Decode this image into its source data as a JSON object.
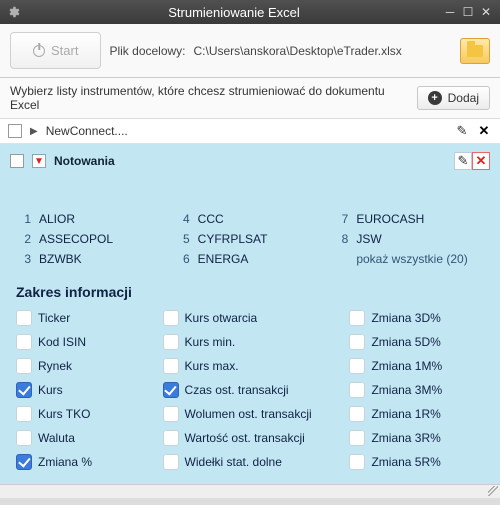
{
  "window": {
    "title": "Strumieniowanie Excel"
  },
  "toolbar": {
    "start_label": "Start",
    "file_label": "Plik docelowy:",
    "file_path": "C:\\Users\\anskora\\Desktop\\eTrader.xlsx"
  },
  "subbar": {
    "text": "Wybierz listy instrumentów, które chcesz strumieniować do dokumentu Excel",
    "add_label": "Dodaj"
  },
  "lists": {
    "row1_label": "NewConnect....",
    "panel_title": "Notowania"
  },
  "tickers": {
    "n1": "1",
    "l1": "ALIOR",
    "n2": "2",
    "l2": "ASSECOPOL",
    "n3": "3",
    "l3": "BZWBK",
    "n4": "4",
    "l4": "CCC",
    "n5": "5",
    "l5": "CYFRPLSAT",
    "n6": "6",
    "l6": "ENERGA",
    "n7": "7",
    "l7": "EUROCASH",
    "n8": "8",
    "l8": "JSW",
    "show_all": "pokaż wszystkie (20)"
  },
  "section_title": "Zakres informacji",
  "checks": {
    "c1": {
      "label": "Ticker",
      "checked": false
    },
    "c2": {
      "label": "Kod ISIN",
      "checked": false
    },
    "c3": {
      "label": "Rynek",
      "checked": false
    },
    "c4": {
      "label": "Kurs",
      "checked": true
    },
    "c5": {
      "label": "Kurs TKO",
      "checked": false
    },
    "c6": {
      "label": "Waluta",
      "checked": false
    },
    "c7": {
      "label": "Zmiana %",
      "checked": true
    },
    "c8": {
      "label": "Kurs otwarcia",
      "checked": false
    },
    "c9": {
      "label": "Kurs min.",
      "checked": false
    },
    "c10": {
      "label": "Kurs max.",
      "checked": false
    },
    "c11": {
      "label": "Czas ost. transakcji",
      "checked": true
    },
    "c12": {
      "label": "Wolumen ost. transakcji",
      "checked": false
    },
    "c13": {
      "label": "Wartość ost. transakcji",
      "checked": false
    },
    "c14": {
      "label": "Widełki stat. dolne",
      "checked": false
    },
    "c15": {
      "label": "Zmiana 3D%",
      "checked": false
    },
    "c16": {
      "label": "Zmiana 5D%",
      "checked": false
    },
    "c17": {
      "label": "Zmiana 1M%",
      "checked": false
    },
    "c18": {
      "label": "Zmiana 3M%",
      "checked": false
    },
    "c19": {
      "label": "Zmiana 1R%",
      "checked": false
    },
    "c20": {
      "label": "Zmiana 3R%",
      "checked": false
    },
    "c21": {
      "label": "Zmiana 5R%",
      "checked": false
    }
  }
}
